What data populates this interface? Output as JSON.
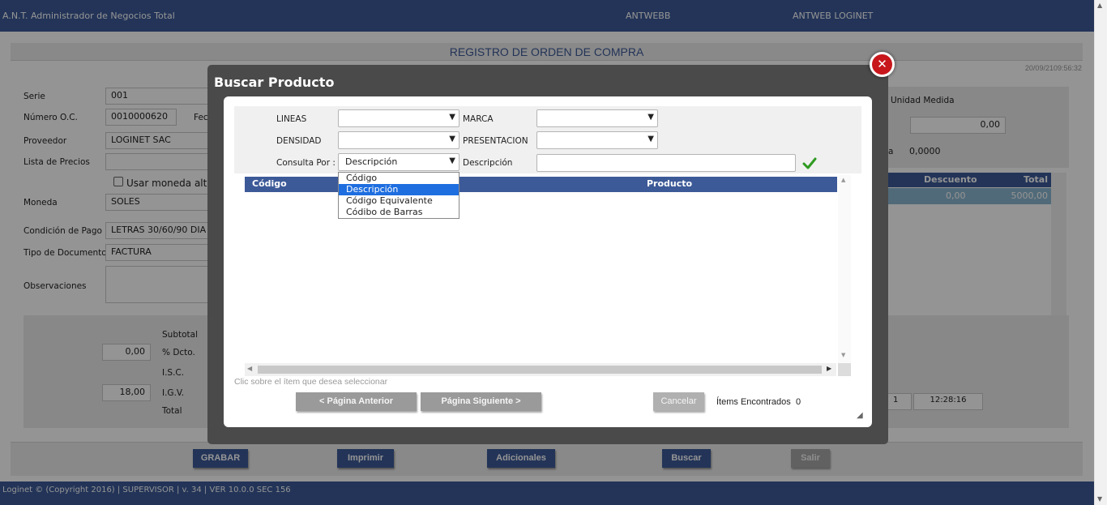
{
  "header": {
    "app_title": "A.N.T. Administrador de Negocios Total",
    "center_label": "ANTWEBB",
    "right_label": "ANTWEB LOGINET"
  },
  "page": {
    "title": "REGISTRO DE ORDEN DE COMPRA",
    "datetime": "20/09/2109:56:32"
  },
  "form": {
    "serie_label": "Serie",
    "serie_value": "001",
    "numero_label": "Número O.C.",
    "numero_value": "0010000620",
    "fecha_label_partial": "Fec",
    "proveedor_label": "Proveedor",
    "proveedor_value": "LOGINET SAC",
    "lista_label": "Lista de Precios",
    "lista_value": "",
    "usar_moneda_label": "Usar moneda alter",
    "moneda_label": "Moneda",
    "moneda_value": "SOLES",
    "condicion_label": "Condición de Pago",
    "condicion_value": "LETRAS 30/60/90 DIA",
    "tipo_doc_label": "Tipo de Documento",
    "tipo_doc_value": "FACTURA",
    "observaciones_label": "Observaciones",
    "observaciones_value": ""
  },
  "right_panel": {
    "unidad_label": "Unidad Medida",
    "amount_value": "0,00",
    "a_fragment": "a",
    "rate_value": "0,0000"
  },
  "detail_grid": {
    "headers": [
      "Descuento",
      "Total"
    ],
    "row": [
      "0,00",
      "5000,00"
    ]
  },
  "summary": {
    "subtotal_label": "Subtotal",
    "dcto_value": "0,00",
    "dcto_label": "% Dcto.",
    "isc_label": "I.S.C.",
    "igv_value": "18,00",
    "igv_label": "I.G.V.",
    "total_label": "Total",
    "time_left": "1",
    "time_right": "12:28:16"
  },
  "bottom_buttons": {
    "grabar": "GRABAR",
    "imprimir": "Imprimir",
    "adicionales": "Adicionales",
    "buscar": "Buscar",
    "salir": "Salir"
  },
  "footer": {
    "text": "Loginet © (Copyright 2016) | SUPERVISOR | v. 34 | VER 10.0.0 SEC 156"
  },
  "modal": {
    "title": "Buscar Producto",
    "close_glyph": "✕",
    "lineas_label": "LINEAS",
    "lineas_value": "",
    "marca_label": "MARCA",
    "marca_value": "",
    "densidad_label": "DENSIDAD",
    "densidad_value": "",
    "presentacion_label": "PRESENTACION",
    "presentacion_value": "",
    "consulta_label": "Consulta Por :",
    "consulta_value": "Descripción",
    "descripcion_label": "Descripción",
    "descripcion_value": "",
    "dropdown_options": [
      "Código",
      "Descripción",
      "Código Equivalente",
      "Códibo de Barras"
    ],
    "results_headers": [
      "Código",
      "Producto"
    ],
    "hint": "Clic sobre el ítem que desea seleccionar",
    "prev_button": "< Página Anterior",
    "next_button": "Página Siguiente >",
    "cancel_button": "Cancelar",
    "items_label": "Ítems Encontrados",
    "items_count": "0"
  },
  "colors": {
    "brand_blue": "#3d5a98",
    "close_red": "#c8171b",
    "check_green": "#2e9a1f",
    "row_highlight": "#8cb7d1"
  }
}
